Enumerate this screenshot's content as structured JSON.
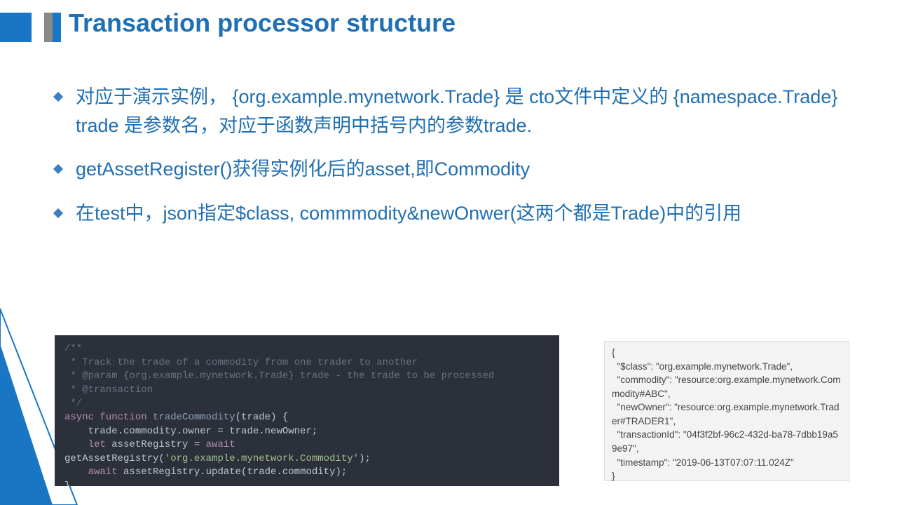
{
  "title": "Transaction processor structure",
  "bullets": [
    "对应于演示实例， {org.example.mynetwork.Trade} 是 cto文件中定义的 {namespace.Trade} trade 是参数名，对应于函数声明中括号内的参数trade.",
    "getAssetRegister()获得实例化后的asset,即Commodity",
    "在test中，json指定$class, commmodity&newOnwer(这两个都是Trade)中的引用"
  ],
  "code": {
    "c1": "/**",
    "c2": " * Track the trade of a commodity from one trader to another",
    "c3": " * @param {org.example.mynetwork.Trade} trade - the trade to be processed",
    "c4": " * @transaction",
    "c5": " */",
    "kw_async": "async",
    "kw_function": "function",
    "fn_name": "tradeCommodity",
    "paren_open": "(trade) {",
    "l1": "    trade.commodity.owner = trade.newOwner;",
    "kw_let": "    let",
    "l2a": " assetRegistry = ",
    "kw_await1": "await",
    "l3a": "getAssetRegistry(",
    "str1": "'org.example.mynetwork.Commodity'",
    "l3b": ");",
    "kw_await2": "    await",
    "l4": " assetRegistry.update(trade.commodity);",
    "close": "}"
  },
  "json": {
    "l1": "{",
    "l2": "  \"$class\": \"org.example.mynetwork.Trade\",",
    "l3": "  \"commodity\": \"resource:org.example.mynetwork.Commodity#ABC\",",
    "l4": "  \"newOwner\": \"resource:org.example.mynetwork.Trader#TRADER1\",",
    "l5": "  \"transactionId\": \"04f3f2bf-96c2-432d-ba78-7dbb19a59e97\",",
    "l6": "  \"timestamp\": \"2019-06-13T07:07:11.024Z\"",
    "l7": "}"
  }
}
